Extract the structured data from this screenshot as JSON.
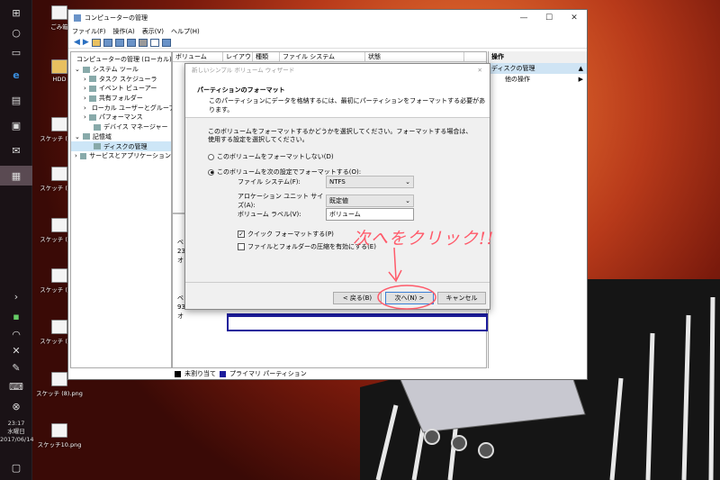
{
  "desktop": {
    "icons": [
      {
        "label": "ごみ箱"
      },
      {
        "label": "HDD"
      },
      {
        "label": "スケッチ (3).g"
      },
      {
        "label": "スケッチ (4).g"
      },
      {
        "label": "スケッチ (5).g"
      },
      {
        "label": "スケッチ (6).g"
      },
      {
        "label": "スケッチ (7).g"
      },
      {
        "label": "スケッチ (8).png"
      },
      {
        "label": "スケッチ10.png"
      }
    ]
  },
  "taskbar": {
    "time": "23:17",
    "weekday": "水曜日",
    "date": "2017/06/14"
  },
  "window": {
    "title": "コンピューターの管理",
    "menu": [
      "ファイル(F)",
      "操作(A)",
      "表示(V)",
      "ヘルプ(H)"
    ],
    "tree": [
      {
        "label": "コンピューターの管理 (ローカル)"
      },
      {
        "label": "システム ツール"
      },
      {
        "label": "タスク スケジューラ"
      },
      {
        "label": "イベント ビューアー"
      },
      {
        "label": "共有フォルダー"
      },
      {
        "label": "ローカル ユーザーとグループ"
      },
      {
        "label": "パフォーマンス"
      },
      {
        "label": "デバイス マネージャー"
      },
      {
        "label": "記憶域"
      },
      {
        "label": "ディスクの管理"
      },
      {
        "label": "サービスとアプリケーション"
      }
    ],
    "columns": [
      "ボリューム",
      "レイアウト",
      "種類",
      "ファイル システム",
      "状態"
    ],
    "disk_fragments": [
      "ベ",
      "23",
      "オ",
      "ベ",
      "93",
      "オ"
    ],
    "legend": {
      "unallocated": "未割り当て",
      "primary": "プライマリ パーティション"
    },
    "actions": {
      "header": "操作",
      "selected": "ディスクの管理",
      "other": "他の操作"
    }
  },
  "dialog": {
    "title": "新しいシンプル ボリューム ウィザード",
    "heading": "パーティションのフォーマット",
    "subheading": "このパーティションにデータを格納するには、最初にパーティションをフォーマットする必要があります。",
    "instruction": "このボリュームをフォーマットするかどうかを選択してください。フォーマットする場合は、使用する設定を選択してください。",
    "radio_no": "このボリュームをフォーマットしない(D)",
    "radio_yes": "このボリュームを次の設定でフォーマットする(O):",
    "fs_label": "ファイル システム(F):",
    "fs_value": "NTFS",
    "alloc_label": "アロケーション ユニット サイズ(A):",
    "alloc_value": "既定値",
    "vol_label": "ボリューム ラベル(V):",
    "vol_value": "ボリューム",
    "quick_format": "クイック フォーマットする(P)",
    "compress": "ファイルとフォルダーの圧縮を有効にする(E)",
    "back": "< 戻る(B)",
    "next": "次へ(N) >",
    "cancel": "キャンセル"
  },
  "annotation": "次へをクリック!!",
  "colors": {
    "primary_partition": "#1c1c9c",
    "unallocated": "#000000",
    "annotation": "#ff5a6a"
  }
}
